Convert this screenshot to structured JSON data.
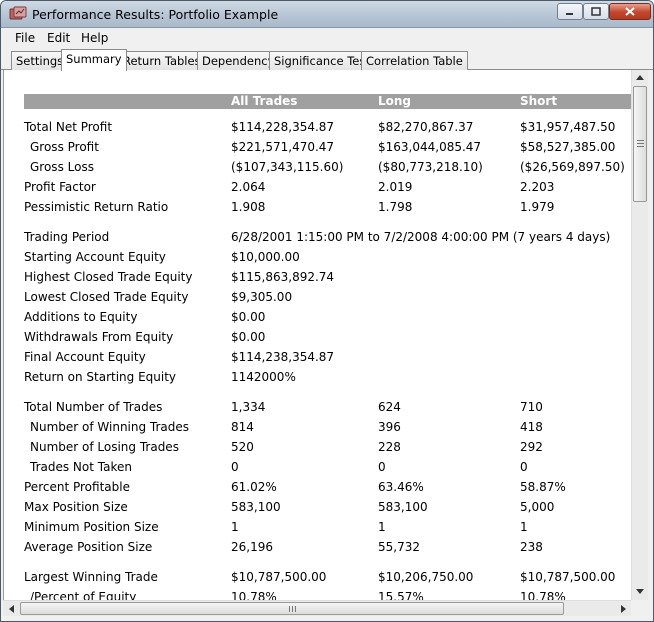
{
  "window": {
    "title": "Performance Results: Portfolio Example"
  },
  "menu": [
    "File",
    "Edit",
    "Help"
  ],
  "tabs": [
    {
      "label": "Settings",
      "active": false
    },
    {
      "label": "Summary",
      "active": true
    },
    {
      "label": "Return Tables",
      "active": false
    },
    {
      "label": "Dependency",
      "active": false
    },
    {
      "label": "Significance Test",
      "active": false
    },
    {
      "label": "Correlation Table",
      "active": false
    }
  ],
  "table": {
    "headers": [
      "All Trades",
      "Long",
      "Short"
    ],
    "rows": [
      {
        "label": "Total Net Profit",
        "indent": false,
        "values": [
          "$114,228,354.87",
          "$82,270,867.37",
          "$31,957,487.50"
        ]
      },
      {
        "label": "Gross Profit",
        "indent": true,
        "values": [
          "$221,571,470.47",
          "$163,044,085.47",
          "$58,527,385.00"
        ]
      },
      {
        "label": "Gross Loss",
        "indent": true,
        "values": [
          "($107,343,115.60)",
          "($80,773,218.10)",
          "($26,569,897.50)"
        ]
      },
      {
        "label": "Profit Factor",
        "indent": false,
        "values": [
          "2.064",
          "2.019",
          "2.203"
        ]
      },
      {
        "label": "Pessimistic Return Ratio",
        "indent": false,
        "values": [
          "1.908",
          "1.798",
          "1.979"
        ]
      },
      {
        "spacer": true
      },
      {
        "label": "Trading Period",
        "indent": false,
        "values": [
          "6/28/2001 1:15:00 PM to 7/2/2008 4:00:00 PM (7 years 4 days)",
          "",
          ""
        ]
      },
      {
        "label": "Starting Account Equity",
        "indent": false,
        "values": [
          "$10,000.00",
          "",
          ""
        ]
      },
      {
        "label": "Highest Closed Trade Equity",
        "indent": false,
        "values": [
          "$115,863,892.74",
          "",
          ""
        ]
      },
      {
        "label": "Lowest Closed Trade Equity",
        "indent": false,
        "values": [
          "$9,305.00",
          "",
          ""
        ]
      },
      {
        "label": "Additions to Equity",
        "indent": false,
        "values": [
          "$0.00",
          "",
          ""
        ]
      },
      {
        "label": "Withdrawals From Equity",
        "indent": false,
        "values": [
          "$0.00",
          "",
          ""
        ]
      },
      {
        "label": "Final Account Equity",
        "indent": false,
        "values": [
          "$114,238,354.87",
          "",
          ""
        ]
      },
      {
        "label": "Return on Starting Equity",
        "indent": false,
        "values": [
          "1142000%",
          "",
          ""
        ]
      },
      {
        "spacer": true
      },
      {
        "label": "Total Number of Trades",
        "indent": false,
        "values": [
          "1,334",
          "624",
          "710"
        ]
      },
      {
        "label": "Number of Winning Trades",
        "indent": true,
        "values": [
          "814",
          "396",
          "418"
        ]
      },
      {
        "label": "Number of Losing Trades",
        "indent": true,
        "values": [
          "520",
          "228",
          "292"
        ]
      },
      {
        "label": "Trades Not Taken",
        "indent": true,
        "values": [
          "0",
          "0",
          "0"
        ]
      },
      {
        "label": "Percent Profitable",
        "indent": false,
        "values": [
          "61.02%",
          "63.46%",
          "58.87%"
        ]
      },
      {
        "label": "Max Position Size",
        "indent": false,
        "values": [
          "583,100",
          "583,100",
          "5,000"
        ]
      },
      {
        "label": "Minimum Position Size",
        "indent": false,
        "values": [
          "1",
          "1",
          "1"
        ]
      },
      {
        "label": "Average Position Size",
        "indent": false,
        "values": [
          "26,196",
          "55,732",
          "238"
        ]
      },
      {
        "spacer": true
      },
      {
        "label": "Largest Winning Trade",
        "indent": false,
        "values": [
          "$10,787,500.00",
          "$10,206,750.00",
          "$10,787,500.00"
        ]
      },
      {
        "label": "/Percent of Equity",
        "indent": true,
        "values": [
          "10.78%",
          "15.57%",
          "10.78%"
        ]
      }
    ]
  }
}
